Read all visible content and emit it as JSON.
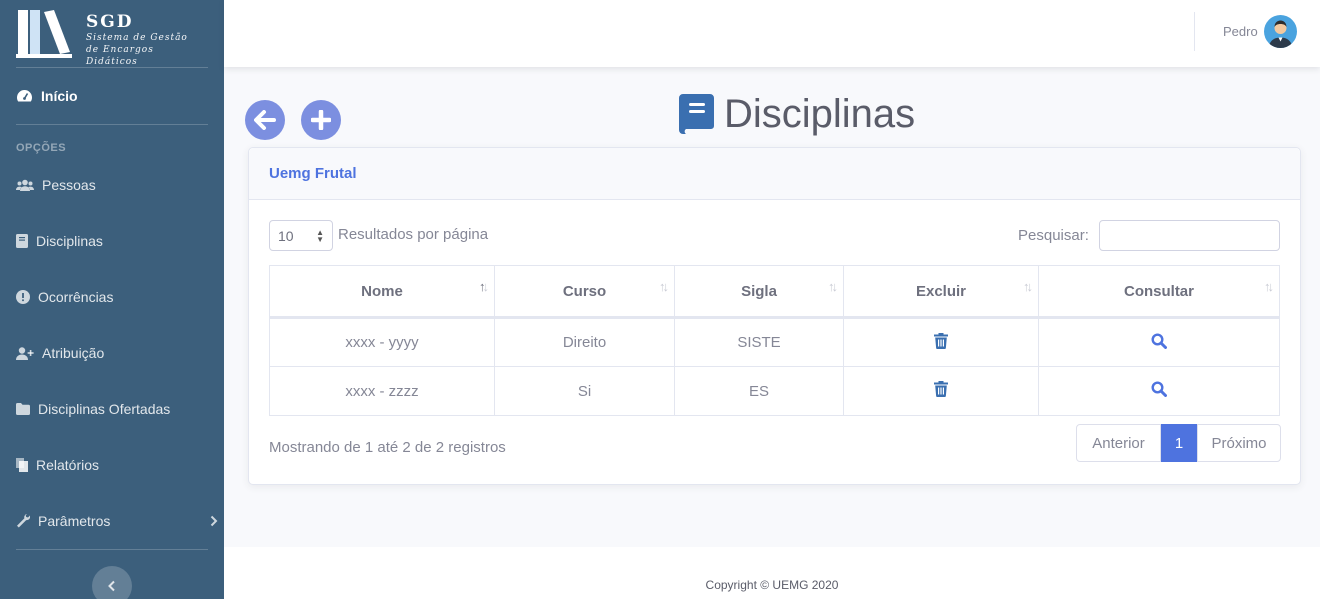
{
  "brand": {
    "title": "SGD",
    "subtitle_line1": "Sistema de Gestão",
    "subtitle_line2": "de Encargos Didáticos"
  },
  "sidebar": {
    "home": "Início",
    "heading": "OPÇÕES",
    "items": [
      {
        "label": "Pessoas",
        "icon": "users-icon"
      },
      {
        "label": "Disciplinas",
        "icon": "book-icon"
      },
      {
        "label": "Ocorrências",
        "icon": "exclamation-icon"
      },
      {
        "label": "Atribuição",
        "icon": "user-plus-icon"
      },
      {
        "label": "Disciplinas Ofertadas",
        "icon": "folder-icon"
      },
      {
        "label": "Relatórios",
        "icon": "copy-icon"
      },
      {
        "label": "Parâmetros",
        "icon": "wrench-icon"
      }
    ]
  },
  "topbar": {
    "user_name": "Pedro"
  },
  "page": {
    "title": "Disciplinas"
  },
  "card": {
    "header": "Uemg Frutal",
    "page_length": "10",
    "page_length_label": "Resultados por página",
    "search_label": "Pesquisar:",
    "search_value": "",
    "columns": [
      "Nome",
      "Curso",
      "Sigla",
      "Excluir",
      "Consultar"
    ],
    "rows": [
      {
        "nome": "xxxx - yyyy",
        "curso": "Direito",
        "sigla": "SISTE"
      },
      {
        "nome": "xxxx - zzzz",
        "curso": "Si",
        "sigla": "ES"
      }
    ],
    "info": "Mostrando de 1 até 2 de 2 registros",
    "pager": {
      "prev": "Anterior",
      "current": "1",
      "next": "Próximo"
    }
  },
  "footer": {
    "copyright": "Copyright © UEMG 2020"
  },
  "colors": {
    "sidebar": "#3c5f7c",
    "primary": "#4e73df",
    "action_button": "#7c8fe0",
    "title_icon": "#3a6fb0"
  }
}
